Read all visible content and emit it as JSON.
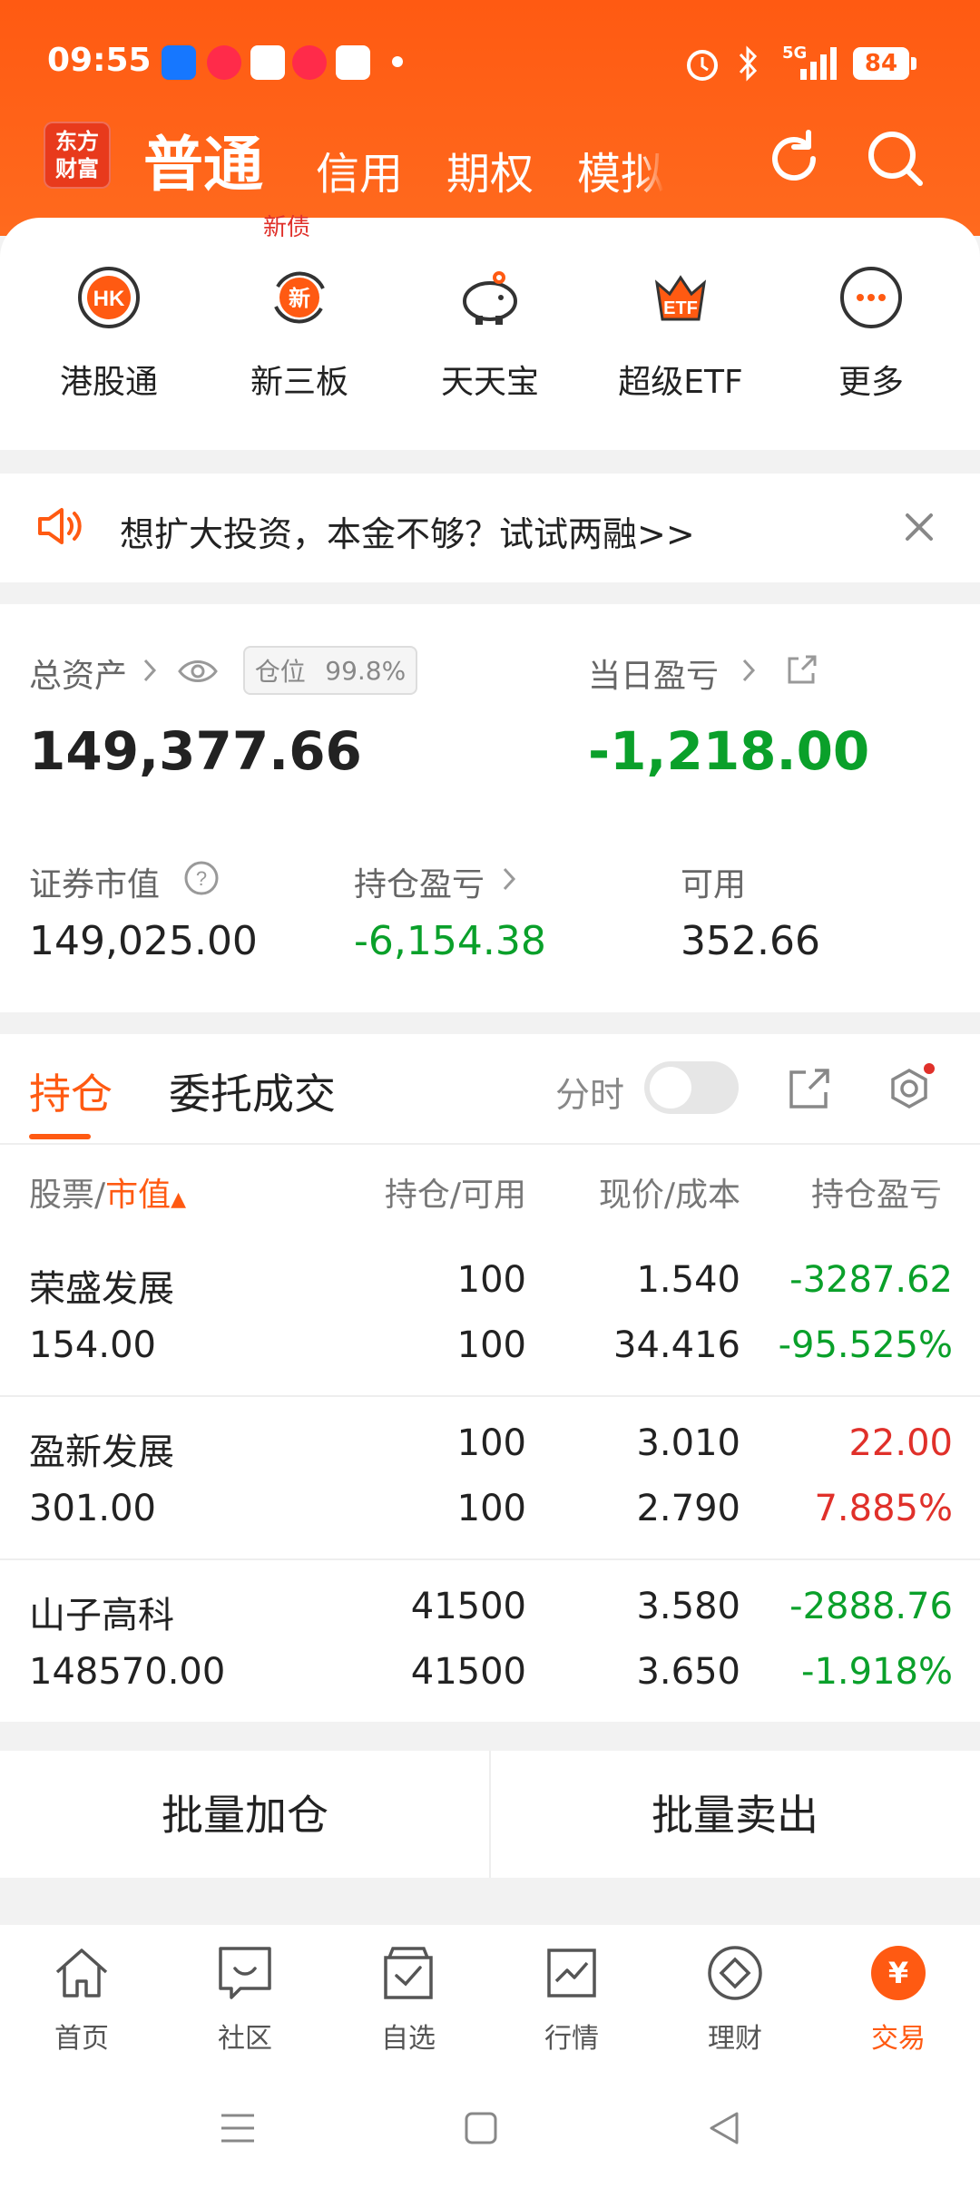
{
  "status_bar": {
    "time": "09:55",
    "battery": "84",
    "network": "5G"
  },
  "header": {
    "logo_line1": "东方",
    "logo_line2": "财富",
    "tabs": [
      "普通",
      "信用",
      "期权",
      "模拟"
    ]
  },
  "quick_menu": {
    "badge": "新债",
    "items": [
      {
        "label": "港股通",
        "icon": "hk-icon"
      },
      {
        "label": "新三板",
        "icon": "new-board-icon"
      },
      {
        "label": "天天宝",
        "icon": "piggy-bank-icon"
      },
      {
        "label": "超级ETF",
        "icon": "etf-crown-icon"
      },
      {
        "label": "更多",
        "icon": "more-icon"
      }
    ]
  },
  "promo": {
    "text": "想扩大投资，本金不够？试试两融>>"
  },
  "assets": {
    "total_label": "总资产",
    "position_label": "仓位",
    "position_value": "99.8%",
    "total_value": "149,377.66",
    "daily_label": "当日盈亏",
    "daily_value": "-1,218.00",
    "market_value_label": "证券市值",
    "market_value": "149,025.00",
    "holding_pnl_label": "持仓盈亏",
    "holding_pnl": "-6,154.38",
    "available_label": "可用",
    "available": "352.66"
  },
  "positions": {
    "tab_holdings": "持仓",
    "tab_orders": "委托成交",
    "timeshare_label": "分时",
    "col_stock": "股票/",
    "col_market_value": "市值",
    "col_qty": "持仓/可用",
    "col_price": "现价/成本",
    "col_pnl": "持仓盈亏",
    "rows": [
      {
        "name": "荣盛发展",
        "mv": "154.00",
        "qty": "100",
        "avail": "100",
        "price": "1.540",
        "cost": "34.416",
        "pnl": "-3287.62",
        "pnl_pct": "-95.525%",
        "color": "#0aa02a"
      },
      {
        "name": "盈新发展",
        "mv": "301.00",
        "qty": "100",
        "avail": "100",
        "price": "3.010",
        "cost": "2.790",
        "pnl": "22.00",
        "pnl_pct": "7.885%",
        "color": "#e0302a"
      },
      {
        "name": "山子高科",
        "mv": "148570.00",
        "qty": "41500",
        "avail": "41500",
        "price": "3.580",
        "cost": "3.650",
        "pnl": "-2888.76",
        "pnl_pct": "-1.918%",
        "color": "#0aa02a"
      }
    ]
  },
  "batch": {
    "add": "批量加仓",
    "sell": "批量卖出"
  },
  "bottom_nav": [
    {
      "label": "首页",
      "icon": "home-icon"
    },
    {
      "label": "社区",
      "icon": "community-icon"
    },
    {
      "label": "自选",
      "icon": "watchlist-icon"
    },
    {
      "label": "行情",
      "icon": "market-icon"
    },
    {
      "label": "理财",
      "icon": "wealth-icon"
    },
    {
      "label": "交易",
      "icon": "trade-icon",
      "active": true
    }
  ],
  "colors": {
    "brand": "#ff5a12",
    "up": "#e0302a",
    "down": "#0aa02a"
  }
}
